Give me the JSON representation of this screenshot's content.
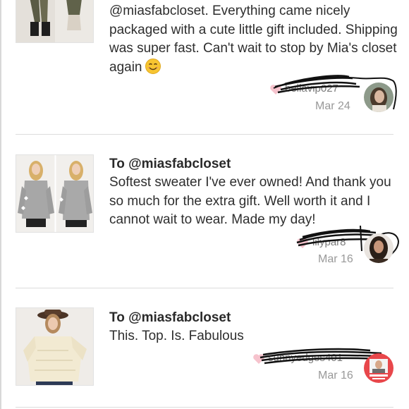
{
  "reviews": [
    {
      "to": "",
      "text": "@miasfabcloset. Everything came nicely packaged with a cute little gift included. Shipping was super fast. Can't wait to stop by Mia's closet again",
      "emoji": "smiling-face",
      "author": "bellavip027",
      "date": "Mar 24"
    },
    {
      "to": "To @miasfabcloset",
      "text": "Softest sweater I've ever owned! And thank you so much for the extra gift. Well worth it and I cannot wait to wear. Made my day!",
      "author": "lilypar8",
      "date": "Mar 16"
    },
    {
      "to": "To @miasfabcloset",
      "text": "This. Top. Is. Fabulous",
      "author": "sunnyedges401",
      "date": "Mar 16"
    }
  ],
  "colors": {
    "heart": "#f6c3cd",
    "divider": "#dcdcdc",
    "date": "#999999",
    "scribble": "#111111"
  }
}
